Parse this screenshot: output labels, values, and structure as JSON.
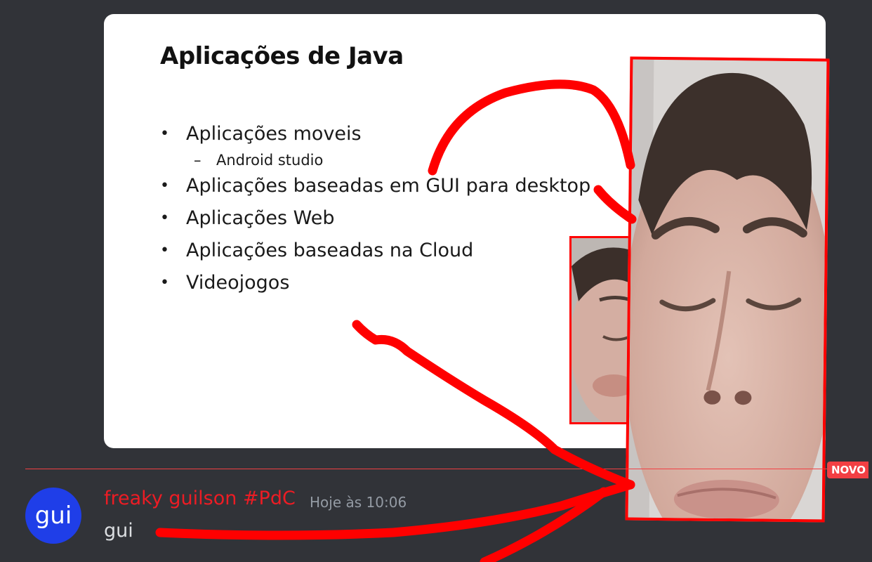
{
  "slide": {
    "title": "Aplicações de Java",
    "bullets": [
      {
        "text": "Aplicações moveis"
      },
      {
        "text": "Aplicações baseadas em GUI para desktop"
      },
      {
        "text": "Aplicações Web"
      },
      {
        "text": "Aplicações baseadas na Cloud"
      },
      {
        "text": "Videojogos"
      }
    ],
    "sub_bullets": [
      {
        "text": "Android studio"
      }
    ],
    "bullet_glyph": "•",
    "dash_glyph": "–"
  },
  "divider": {
    "badge": "NOVO",
    "color": "#f23f43"
  },
  "message": {
    "avatar_text": "gui",
    "avatar_color": "#1f3ee8",
    "author": "freaky guilson #PdC",
    "author_color": "#ed1c24",
    "timestamp": "Hoje às 10:06",
    "content": "gui"
  },
  "annotations": {
    "scribble_color": "#ff0000"
  },
  "colors": {
    "background": "#313338",
    "text": "#dbdee1",
    "muted": "#949ba4"
  }
}
